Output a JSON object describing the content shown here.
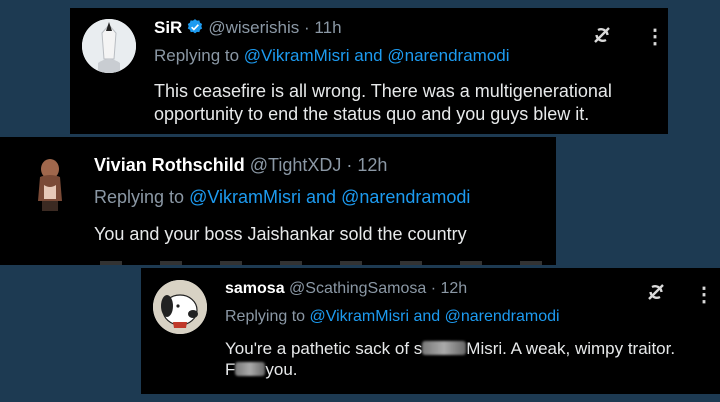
{
  "tweets": [
    {
      "name": "SiR",
      "handle": "@wiserishis",
      "dot": "·",
      "time": "11h",
      "reply_prefix": "Replying to",
      "mention1": "@VikramMisri",
      "reply_and": "and",
      "mention2": "@narendramodi",
      "body": "This ceasefire is all wrong. There was a multigenerational opportunity to end the status quo and you guys blew it.",
      "verified": true,
      "icons": [
        "grok-icon",
        "more-icon"
      ]
    },
    {
      "name": "Vivian Rothschild",
      "handle": "@TightXDJ",
      "dot": "·",
      "time": "12h",
      "reply_prefix": "Replying to",
      "mention1": "@VikramMisri",
      "reply_and": "and",
      "mention2": "@narendramodi",
      "body": "You and your boss Jaishankar sold the country"
    },
    {
      "name": "samosa",
      "handle": "@ScathingSamosa",
      "dot": "·",
      "time": "12h",
      "reply_prefix": "Replying to",
      "mention1": "@VikramMisri",
      "reply_and": "and",
      "mention2": "@narendramodi",
      "body_part1": "You're a pathetic sack of s",
      "body_part2": "Misri. A weak, wimpy traitor.",
      "body_part3": "F",
      "body_part4": "you.",
      "icons": [
        "grok-icon",
        "more-icon"
      ]
    }
  ],
  "colors": {
    "background": "#1d3a52",
    "card": "#000000",
    "mention": "#1d9bf0",
    "secondary": "#8b98a5",
    "verified": "#1d9bf0"
  }
}
